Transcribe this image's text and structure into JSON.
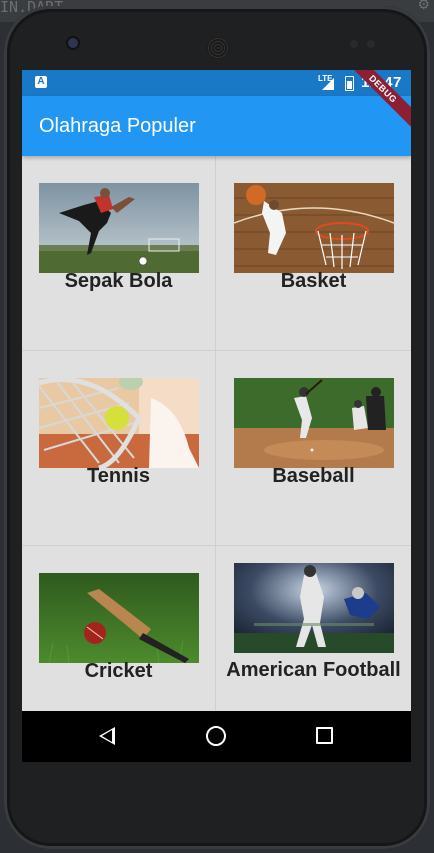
{
  "ide": {
    "filename_fragment": "IN.DART"
  },
  "status_bar": {
    "time": "12:47",
    "network": "LTE"
  },
  "app_bar": {
    "title": "Olahraga Populer"
  },
  "debug_banner": "DEBUG",
  "sports": [
    {
      "label": "Sepak Bola",
      "image": "soccer-player-kicking-photo"
    },
    {
      "label": "Basket",
      "image": "basketball-dunk-photo"
    },
    {
      "label": "Tennis",
      "image": "tennis-racket-ball-photo"
    },
    {
      "label": "Baseball",
      "image": "baseball-batter-photo"
    },
    {
      "label": "Cricket",
      "image": "cricket-bat-ball-photo"
    },
    {
      "label": "American Football",
      "image": "american-football-player-photo"
    }
  ],
  "nav_bar": {
    "icons": [
      "back-icon",
      "home-icon",
      "recent-apps-icon"
    ]
  },
  "colors": {
    "status_bar": "#1a79c7",
    "app_bar": "#2196f3",
    "grid_bg": "#e0e0e0",
    "debug": "#8c1f33"
  }
}
